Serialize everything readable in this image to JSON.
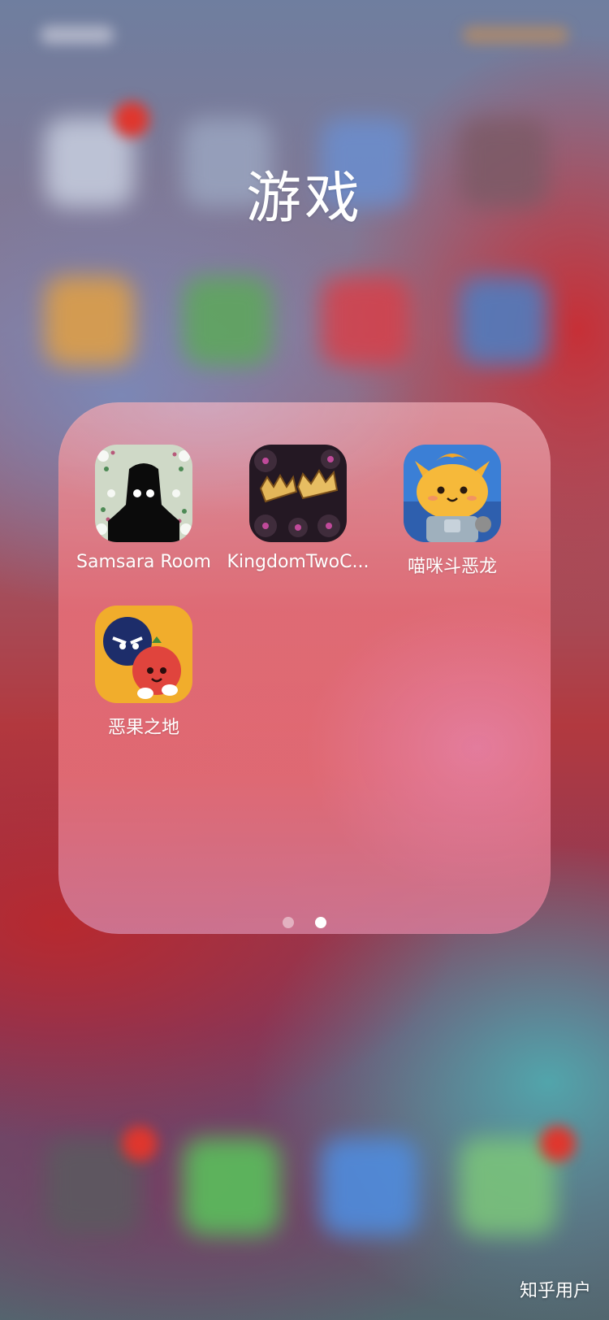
{
  "folder": {
    "title": "游戏",
    "apps": [
      {
        "label": "Samsara Room",
        "icon": "samsara-room-icon"
      },
      {
        "label": "KingdomTwoC...",
        "icon": "kingdom-crowns-icon"
      },
      {
        "label": "喵咪斗恶龙",
        "icon": "cat-knight-icon"
      },
      {
        "label": "恶果之地",
        "icon": "bad-fruit-icon"
      }
    ],
    "pages": {
      "count": 2,
      "current": 2
    }
  },
  "watermark": "知乎用户"
}
